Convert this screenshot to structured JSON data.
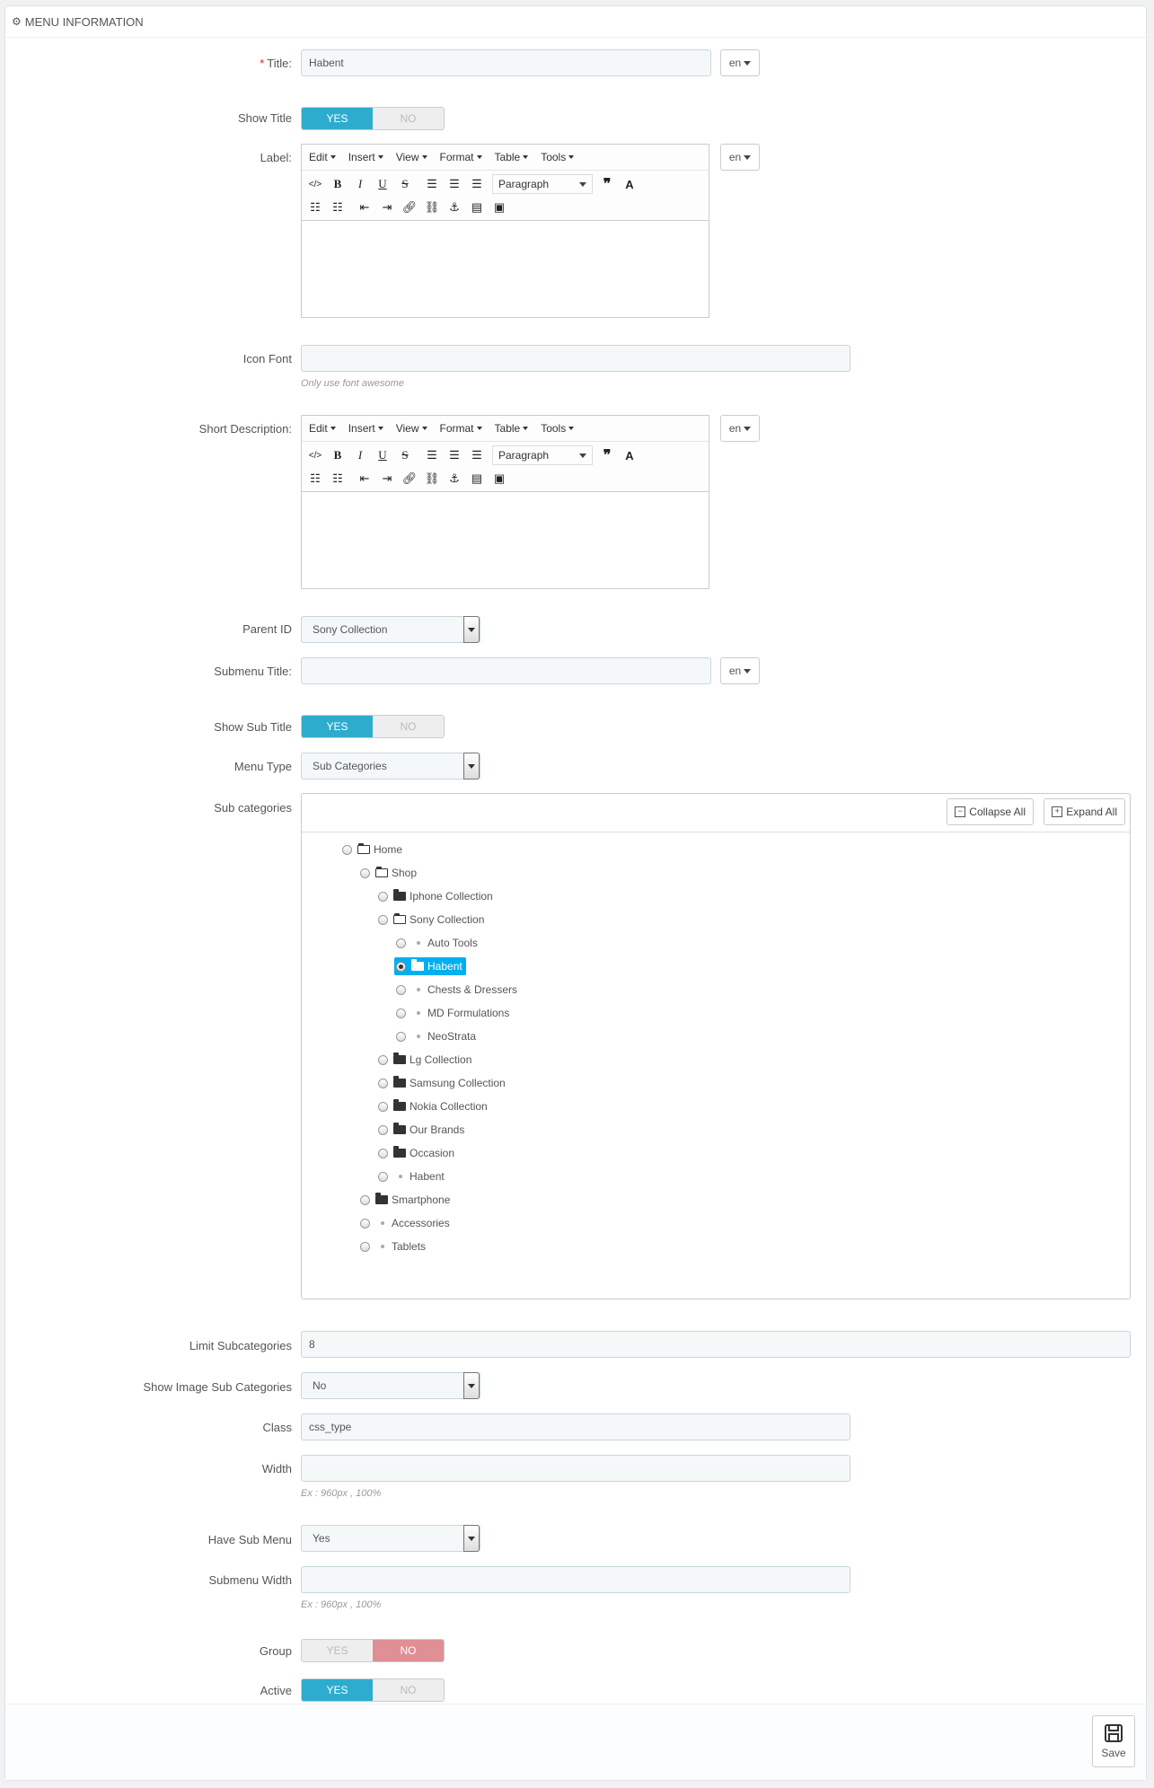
{
  "panel": {
    "title": "MENU INFORMATION",
    "heading_icon": "cogs-icon"
  },
  "title_field": {
    "label": "Title:",
    "required": "*",
    "value": "Habent",
    "lang": "en"
  },
  "show_title": {
    "label": "Show Title",
    "yes": "YES",
    "no": "NO",
    "selected": "YES"
  },
  "label_field": {
    "label": "Label:",
    "lang": "en"
  },
  "editor": {
    "menus": [
      "Edit",
      "Insert",
      "View",
      "Format",
      "Table",
      "Tools"
    ],
    "paragraph": "Paragraph"
  },
  "icon_font": {
    "label": "Icon Font",
    "value": "",
    "help": "Only use font awesome"
  },
  "short_desc": {
    "label": "Short Description:",
    "lang": "en"
  },
  "parent_id": {
    "label": "Parent ID",
    "value": "Sony Collection"
  },
  "submenu_title": {
    "label": "Submenu Title:",
    "value": "",
    "lang": "en"
  },
  "show_sub_title": {
    "label": "Show Sub Title",
    "yes": "YES",
    "no": "NO",
    "selected": "YES"
  },
  "menu_type": {
    "label": "Menu Type",
    "value": "Sub Categories"
  },
  "sub_categories": {
    "label": "Sub categories",
    "collapse_all": "Collapse All",
    "expand_all": "Expand All",
    "tree": [
      {
        "label": "Home",
        "icon": "open-folder",
        "level": 0
      },
      {
        "label": "Shop",
        "icon": "open-folder",
        "level": 1
      },
      {
        "label": "Iphone Collection",
        "icon": "folder",
        "level": 2
      },
      {
        "label": "Sony Collection",
        "icon": "open-folder",
        "level": 2
      },
      {
        "label": "Auto Tools",
        "icon": "dot",
        "level": 3
      },
      {
        "label": "Habent",
        "icon": "folder",
        "level": 3,
        "selected": true
      },
      {
        "label": "Chests & Dressers",
        "icon": "dot",
        "level": 3
      },
      {
        "label": "MD Formulations",
        "icon": "dot",
        "level": 3
      },
      {
        "label": "NeoStrata",
        "icon": "dot",
        "level": 3
      },
      {
        "label": "Lg Collection",
        "icon": "folder",
        "level": 2
      },
      {
        "label": "Samsung Collection",
        "icon": "folder",
        "level": 2
      },
      {
        "label": "Nokia Collection",
        "icon": "folder",
        "level": 2
      },
      {
        "label": "Our Brands",
        "icon": "folder",
        "level": 2
      },
      {
        "label": "Occasion",
        "icon": "folder",
        "level": 2
      },
      {
        "label": "Habent",
        "icon": "dot",
        "level": 2
      },
      {
        "label": "Smartphone",
        "icon": "folder",
        "level": 1
      },
      {
        "label": "Accessories",
        "icon": "dot",
        "level": 1
      },
      {
        "label": "Tablets",
        "icon": "dot",
        "level": 1
      }
    ]
  },
  "limit_sub": {
    "label": "Limit Subcategories",
    "value": "8"
  },
  "show_image_sub": {
    "label": "Show Image Sub Categories",
    "value": "No"
  },
  "class_field": {
    "label": "Class",
    "value": "css_type"
  },
  "width_field": {
    "label": "Width",
    "value": "",
    "help": "Ex : 960px , 100%"
  },
  "have_sub_menu": {
    "label": "Have Sub Menu",
    "value": "Yes"
  },
  "submenu_width": {
    "label": "Submenu Width",
    "value": "",
    "help": "Ex : 960px , 100%"
  },
  "group": {
    "label": "Group",
    "yes": "YES",
    "no": "NO",
    "selected": "NO"
  },
  "active": {
    "label": "Active",
    "yes": "YES",
    "no": "NO",
    "selected": "YES"
  },
  "footer": {
    "save": "Save"
  },
  "colors": {
    "accent": "#2eacce",
    "no_active": "#e08f95",
    "selected_node": "#00aff0"
  }
}
